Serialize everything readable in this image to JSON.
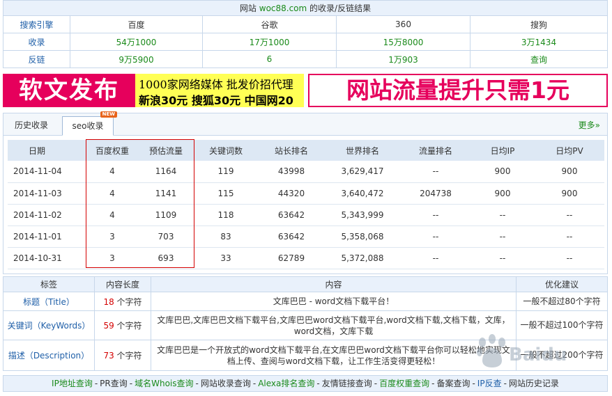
{
  "top": {
    "title_prefix": "网站",
    "site": "woc88.com",
    "title_suffix": "的收录/反链结果",
    "headers": [
      "搜索引擎",
      "百度",
      "谷歌",
      "360",
      "搜狗"
    ],
    "rows": [
      {
        "label": "收录",
        "values": [
          "54万1000",
          "17万1000",
          "15万8000",
          "3万1434"
        ]
      },
      {
        "label": "反链",
        "values": [
          "9万5900",
          "6",
          "1万903",
          "查询"
        ]
      }
    ]
  },
  "banner": {
    "left_big": "软文发布",
    "left_line1": "1000家网络媒体  批发价招代理",
    "left_line2": "新浪30元 搜狐30元 中国网20",
    "right": "网站流量提升只需1元"
  },
  "panel": {
    "tabs": [
      "历史收录",
      "seo收录"
    ],
    "new_badge": "NEW",
    "more": "更多»",
    "columns": [
      "日期",
      "百度权重",
      "预估流量",
      "关键词数",
      "站长排名",
      "世界排名",
      "流量排名",
      "日均IP",
      "日均PV"
    ],
    "rows": [
      [
        "2014-11-04",
        "4",
        "1164",
        "119",
        "43998",
        "3,629,417",
        "--",
        "900",
        "900"
      ],
      [
        "2014-11-03",
        "4",
        "1141",
        "115",
        "44320",
        "3,640,472",
        "204738",
        "900",
        "900"
      ],
      [
        "2014-11-02",
        "4",
        "1109",
        "118",
        "63642",
        "5,343,999",
        "--",
        "--",
        "--"
      ],
      [
        "2014-11-01",
        "3",
        "703",
        "83",
        "63642",
        "5,358,068",
        "--",
        "--",
        "--"
      ],
      [
        "2014-10-31",
        "3",
        "693",
        "33",
        "62789",
        "5,372,088",
        "--",
        "--",
        "--"
      ]
    ]
  },
  "meta": {
    "headers": [
      "标签",
      "内容长度",
      "内容",
      "优化建议"
    ],
    "rows": [
      {
        "label": "标题（Title）",
        "length": "18",
        "unit": "个字符",
        "content": "文库巴巴 - word文档下载平台！",
        "suggestion": "一般不超过80个字符"
      },
      {
        "label": "关键词（KeyWords）",
        "length": "59",
        "unit": "个字符",
        "content": "文库巴巴,文库巴巴文档下载平台,文库巴巴word文档下载平台,word文档下载,文档下载，文库，word文档，文库下载",
        "suggestion": "一般不超过100个字符"
      },
      {
        "label": "描述（Description）",
        "length": "73",
        "unit": "个字符",
        "content": "文库巴巴是一个开放式的word文档下载平台,在文库巴巴word文档下载平台你可以轻松地实现文档上传、查阅与word文档下载，让工作生活变得更轻松！",
        "suggestion": "一般不超过200个字符"
      }
    ]
  },
  "footer": {
    "links": [
      "IP地址查询",
      "PR查询",
      "域名Whois查询",
      "网站收录查询",
      "Alexa排名查询",
      "友情链接查询",
      "百度权重查询",
      "备案查询",
      "IP反查",
      "网站历史记录"
    ],
    "separator": "-"
  },
  "colors": {
    "accent_green": "#1a8a1a",
    "link_blue": "#1f5fa8",
    "highlight_red": "#d40000",
    "header_bg": "#e9f1fb",
    "banner_pink": "#e6005c",
    "banner_yellow": "#ffff55"
  }
}
